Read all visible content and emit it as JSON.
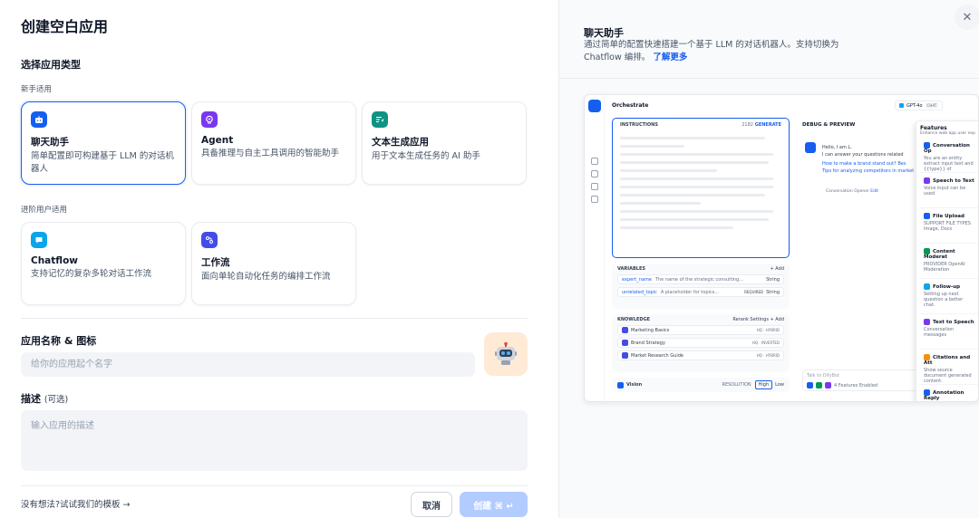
{
  "title": "创建空白应用",
  "app_type_heading": "选择应用类型",
  "beginner_label": "新手适用",
  "advanced_label": "进阶用户适用",
  "cards": [
    {
      "title": "聊天助手",
      "desc": "简单配置即可构建基于 LLM 的对话机器人"
    },
    {
      "title": "Agent",
      "desc": "具备推理与自主工具调用的智能助手"
    },
    {
      "title": "文本生成应用",
      "desc": "用于文本生成任务的 AI 助手"
    },
    {
      "title": "Chatflow",
      "desc": "支持记忆的复杂多轮对话工作流"
    },
    {
      "title": "工作流",
      "desc": "面向单轮自动化任务的编排工作流"
    }
  ],
  "name_label": "应用名称 & 图标",
  "name_placeholder": "给你的应用起个名字",
  "desc_label": "描述",
  "desc_optional": "(可选)",
  "desc_placeholder": "输入应用的描述",
  "template_link": "没有想法?试试我们的模板 →",
  "cancel": "取消",
  "create": "创建 ⌘ ↵",
  "right_title": "聊天助手",
  "right_desc": "通过简单的配置快速搭建一个基于 LLM 的对话机器人。支持切换为 Chatflow 编排。",
  "learn_more": "了解更多",
  "preview": {
    "orchestrate": "Orchestrate",
    "model": "GPT-4o",
    "model_tag": "CHAT",
    "instructions": "INSTRUCTIONS",
    "instr_count": "2182",
    "generate": "GENERATE",
    "debug": "DEBUG & PREVIEW",
    "hello": "Hello, I am L.",
    "can_answer": "I can answer your questions related",
    "q1": "How to make a brand stand out?",
    "q1b": "Bes",
    "q2": "Tips for analyzing competitors in market",
    "opener": "Conversation Opener",
    "opener_edit": "Edit",
    "variables": "VARIABLES",
    "add": "+ Add",
    "var1_name": "expert_name",
    "var1_desc": "The name of the strategic consulting...",
    "var1_type": "String",
    "var2_name": "unrelated_topic",
    "var2_desc": "A placeholder for topics...",
    "var2_req": "REQUIRED",
    "var2_type": "String",
    "knowledge": "KNOWLEDGE",
    "rerank": "Rerank Settings",
    "kb1": "Marketing Basics",
    "kb1_tag": "HQ · HYBRID",
    "kb2": "Brand Strategy",
    "kb2_tag": "HQ · INVERTED",
    "kb3": "Market Research Guide",
    "kb3_tag": "HQ · HYBRID",
    "vision": "Vision",
    "resolution": "RESOLUTION",
    "high": "High",
    "low": "Low",
    "talk": "Talk to DifyBot",
    "features_enabled": "4 Features Enabled",
    "features_title": "Features",
    "features_sub": "Enhance web app user exp",
    "features": [
      {
        "name": "Conversation Op",
        "desc": "You are an entity extract input text and {{type}} of",
        "color": "#155eef"
      },
      {
        "name": "Speech to Text",
        "desc": "Voice input can be used",
        "color": "#7839ee"
      },
      {
        "name": "File Upload",
        "desc": "SUPPORT FILE TYPES Image, Docs",
        "color": "#155eef"
      },
      {
        "name": "Content Moderat",
        "desc": "PROVIDER OpenAI Moderation",
        "color": "#039855"
      },
      {
        "name": "Follow-up",
        "desc": "Setting up next question a better chat.",
        "color": "#0ba5ec"
      },
      {
        "name": "Text to Speech",
        "desc": "Conversation messages",
        "color": "#7839ee"
      },
      {
        "name": "Citations and Att",
        "desc": "Show source document generated content.",
        "color": "#f79009"
      },
      {
        "name": "Annotation Reply",
        "desc": "",
        "color": "#155eef"
      }
    ]
  },
  "colors": {
    "primary": "#155eef",
    "create_disabled": "#b2ccff"
  }
}
